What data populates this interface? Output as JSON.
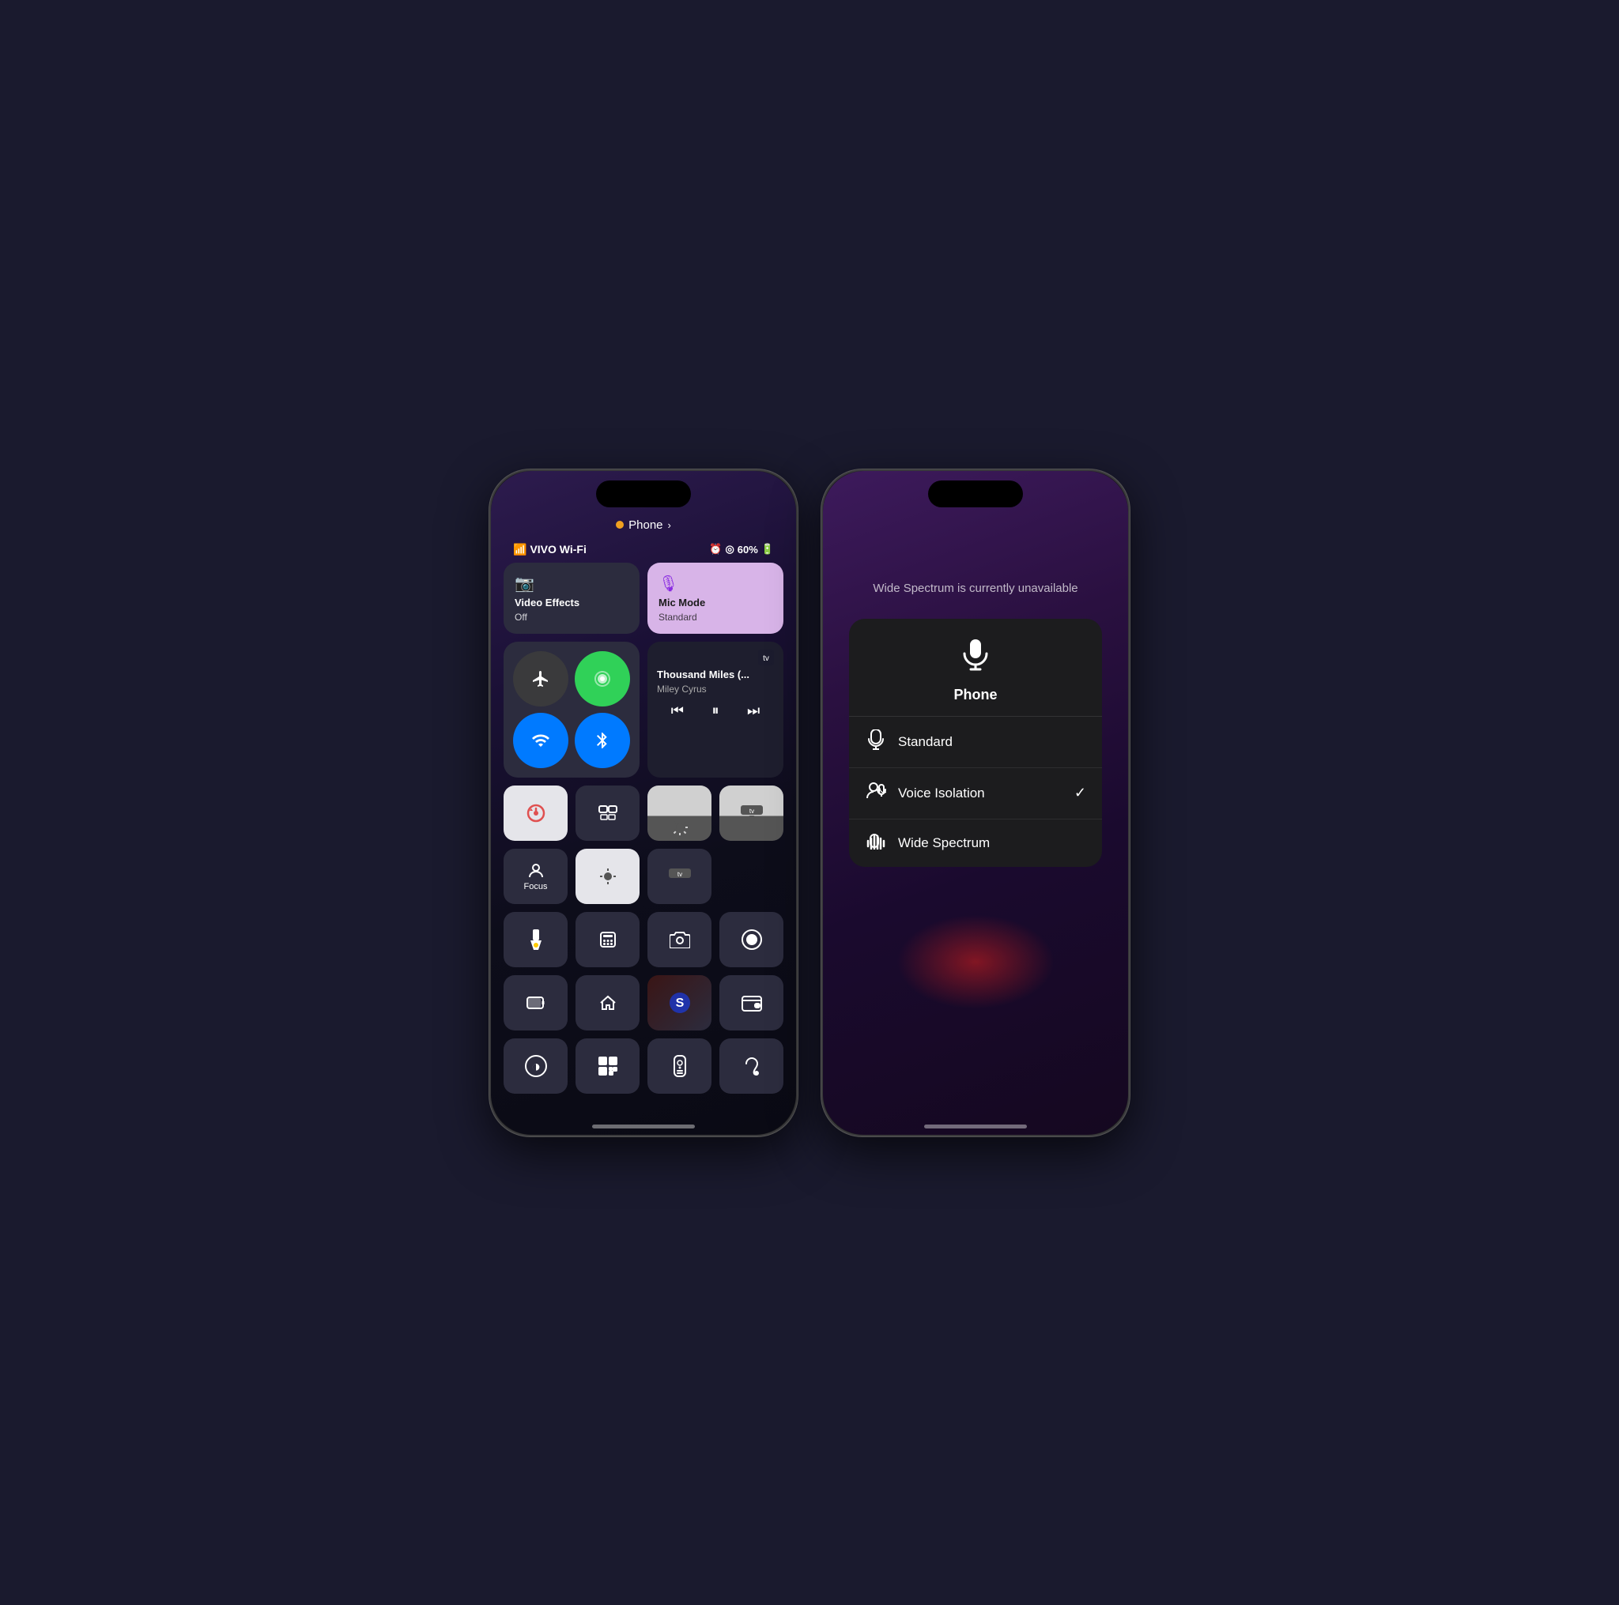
{
  "phone_left": {
    "status": {
      "carrier": "VIVO Wi-Fi",
      "battery": "60%",
      "icons": "signal wifi alarm clock battery"
    },
    "phone_indicator": {
      "label": "Phone",
      "chevron": "›"
    },
    "video_effects": {
      "label": "Video Effects",
      "sublabel": "Off"
    },
    "mic_mode": {
      "label": "Mic Mode",
      "sublabel": "Standard"
    },
    "now_playing": {
      "title": "Thousand Miles (...",
      "artist": "Miley Cyrus"
    },
    "toggles": {
      "airplane": "✈",
      "hotspot": "📡",
      "wifi": "wifi",
      "bluetooth": "bt"
    },
    "tiles": {
      "rotation_lock": "🔒",
      "screen_mirror": "⊡",
      "focus": "Focus",
      "focus_icon": "👤",
      "flashlight": "🔦",
      "calculator": "🔢",
      "camera": "📷",
      "screen_record": "⏺",
      "battery": "🔋",
      "home": "🏠",
      "shazam": "S",
      "wallet": "💳",
      "accessibility": "◑",
      "qr_code": "⊞",
      "remote": "remote",
      "hearing": "hearing"
    }
  },
  "phone_right": {
    "unavailable_text": "Wide Spectrum is currently unavailable",
    "mic_menu": {
      "title": "Phone",
      "options": [
        {
          "label": "Standard",
          "icon": "mic",
          "checked": false
        },
        {
          "label": "Voice Isolation",
          "icon": "voice",
          "checked": true
        },
        {
          "label": "Wide Spectrum",
          "icon": "spectrum",
          "checked": false
        }
      ]
    }
  }
}
